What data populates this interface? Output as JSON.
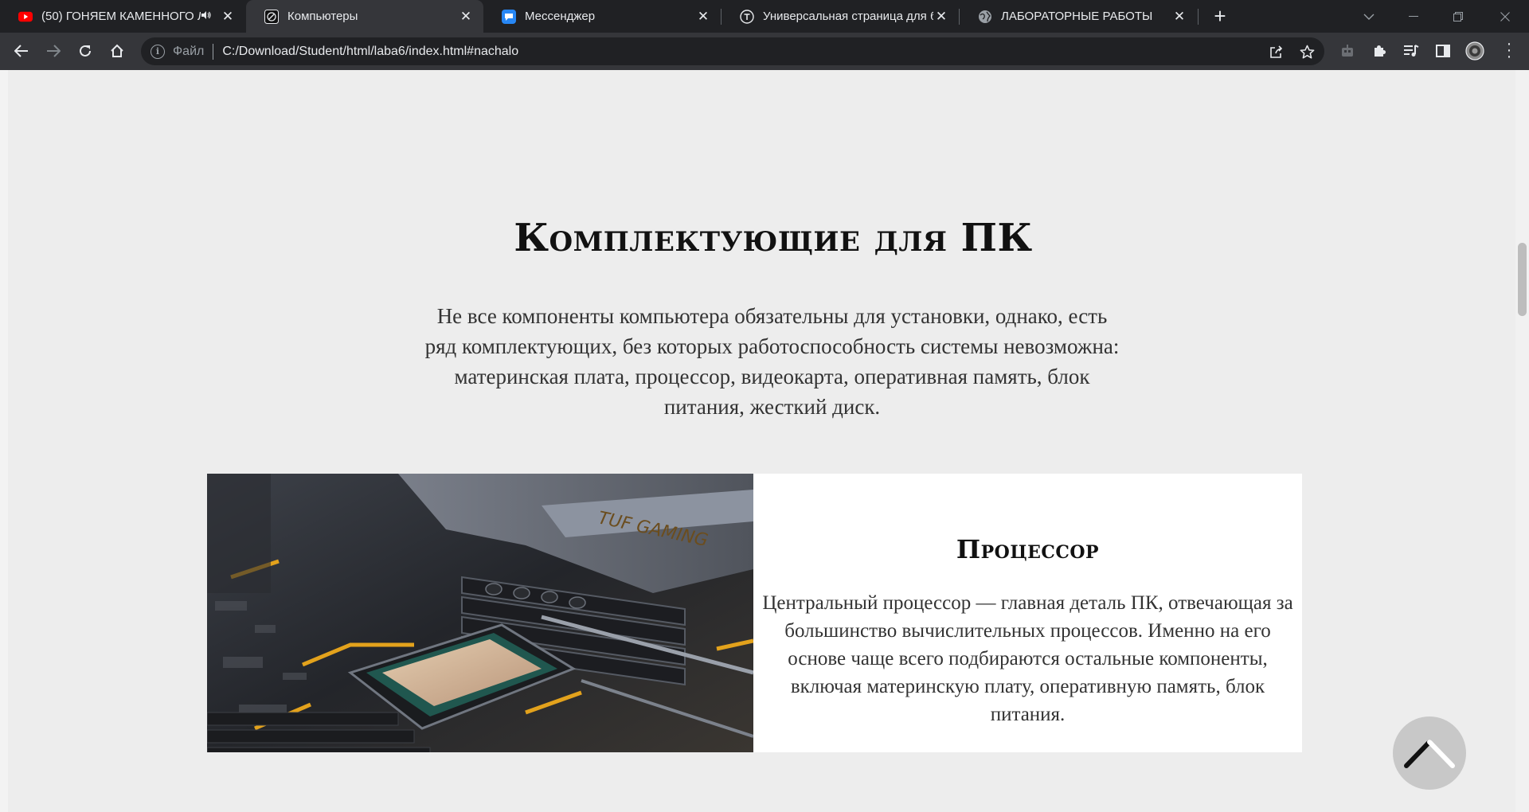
{
  "tabs": [
    {
      "title": "(50) ГОНЯЕМ КАМЕННОГО Л",
      "favicon": "youtube-icon",
      "audio": true
    },
    {
      "title": "Компьютеры",
      "favicon": "page-logo-icon",
      "active": true
    },
    {
      "title": "Мессенджер",
      "favicon": "messenger-icon"
    },
    {
      "title": "Универсальная страница для бл",
      "favicon": "tilda-icon"
    },
    {
      "title": "ЛАБОРАТОРНЫЕ РАБОТЫ",
      "favicon": "globe-icon"
    }
  ],
  "omnibox": {
    "scheme_label": "Файл",
    "url": "C:/Download/Student/html/laba6/index.html#nachalo"
  },
  "page": {
    "section_title": "Комплектующие для ПК",
    "section_lead": "Не все компоненты компьютера обязательны для установки, однако, есть ряд комплектующих, без которых работоспособность системы невозможна: материнская плата, процессор, видеокарта, оперативная память, блок питания, жесткий диск.",
    "card": {
      "title": "Процессор",
      "text": "Центральный процессор — главная деталь ПК, отвечающая за большинство вычислительных процессов. Именно на его основе чаще всего подбираются остальные компоненты, включая материнскую плату, оперативную память, блок питания.",
      "image_alt": "processor-on-motherboard-photo",
      "image_text": "TUF GAMING"
    }
  },
  "colors": {
    "tabstrip": "#202124",
    "toolbar": "#35363a",
    "page_bg": "#ededed",
    "card_bg": "#ffffff",
    "to_top_bg": "#c8c8c8"
  }
}
